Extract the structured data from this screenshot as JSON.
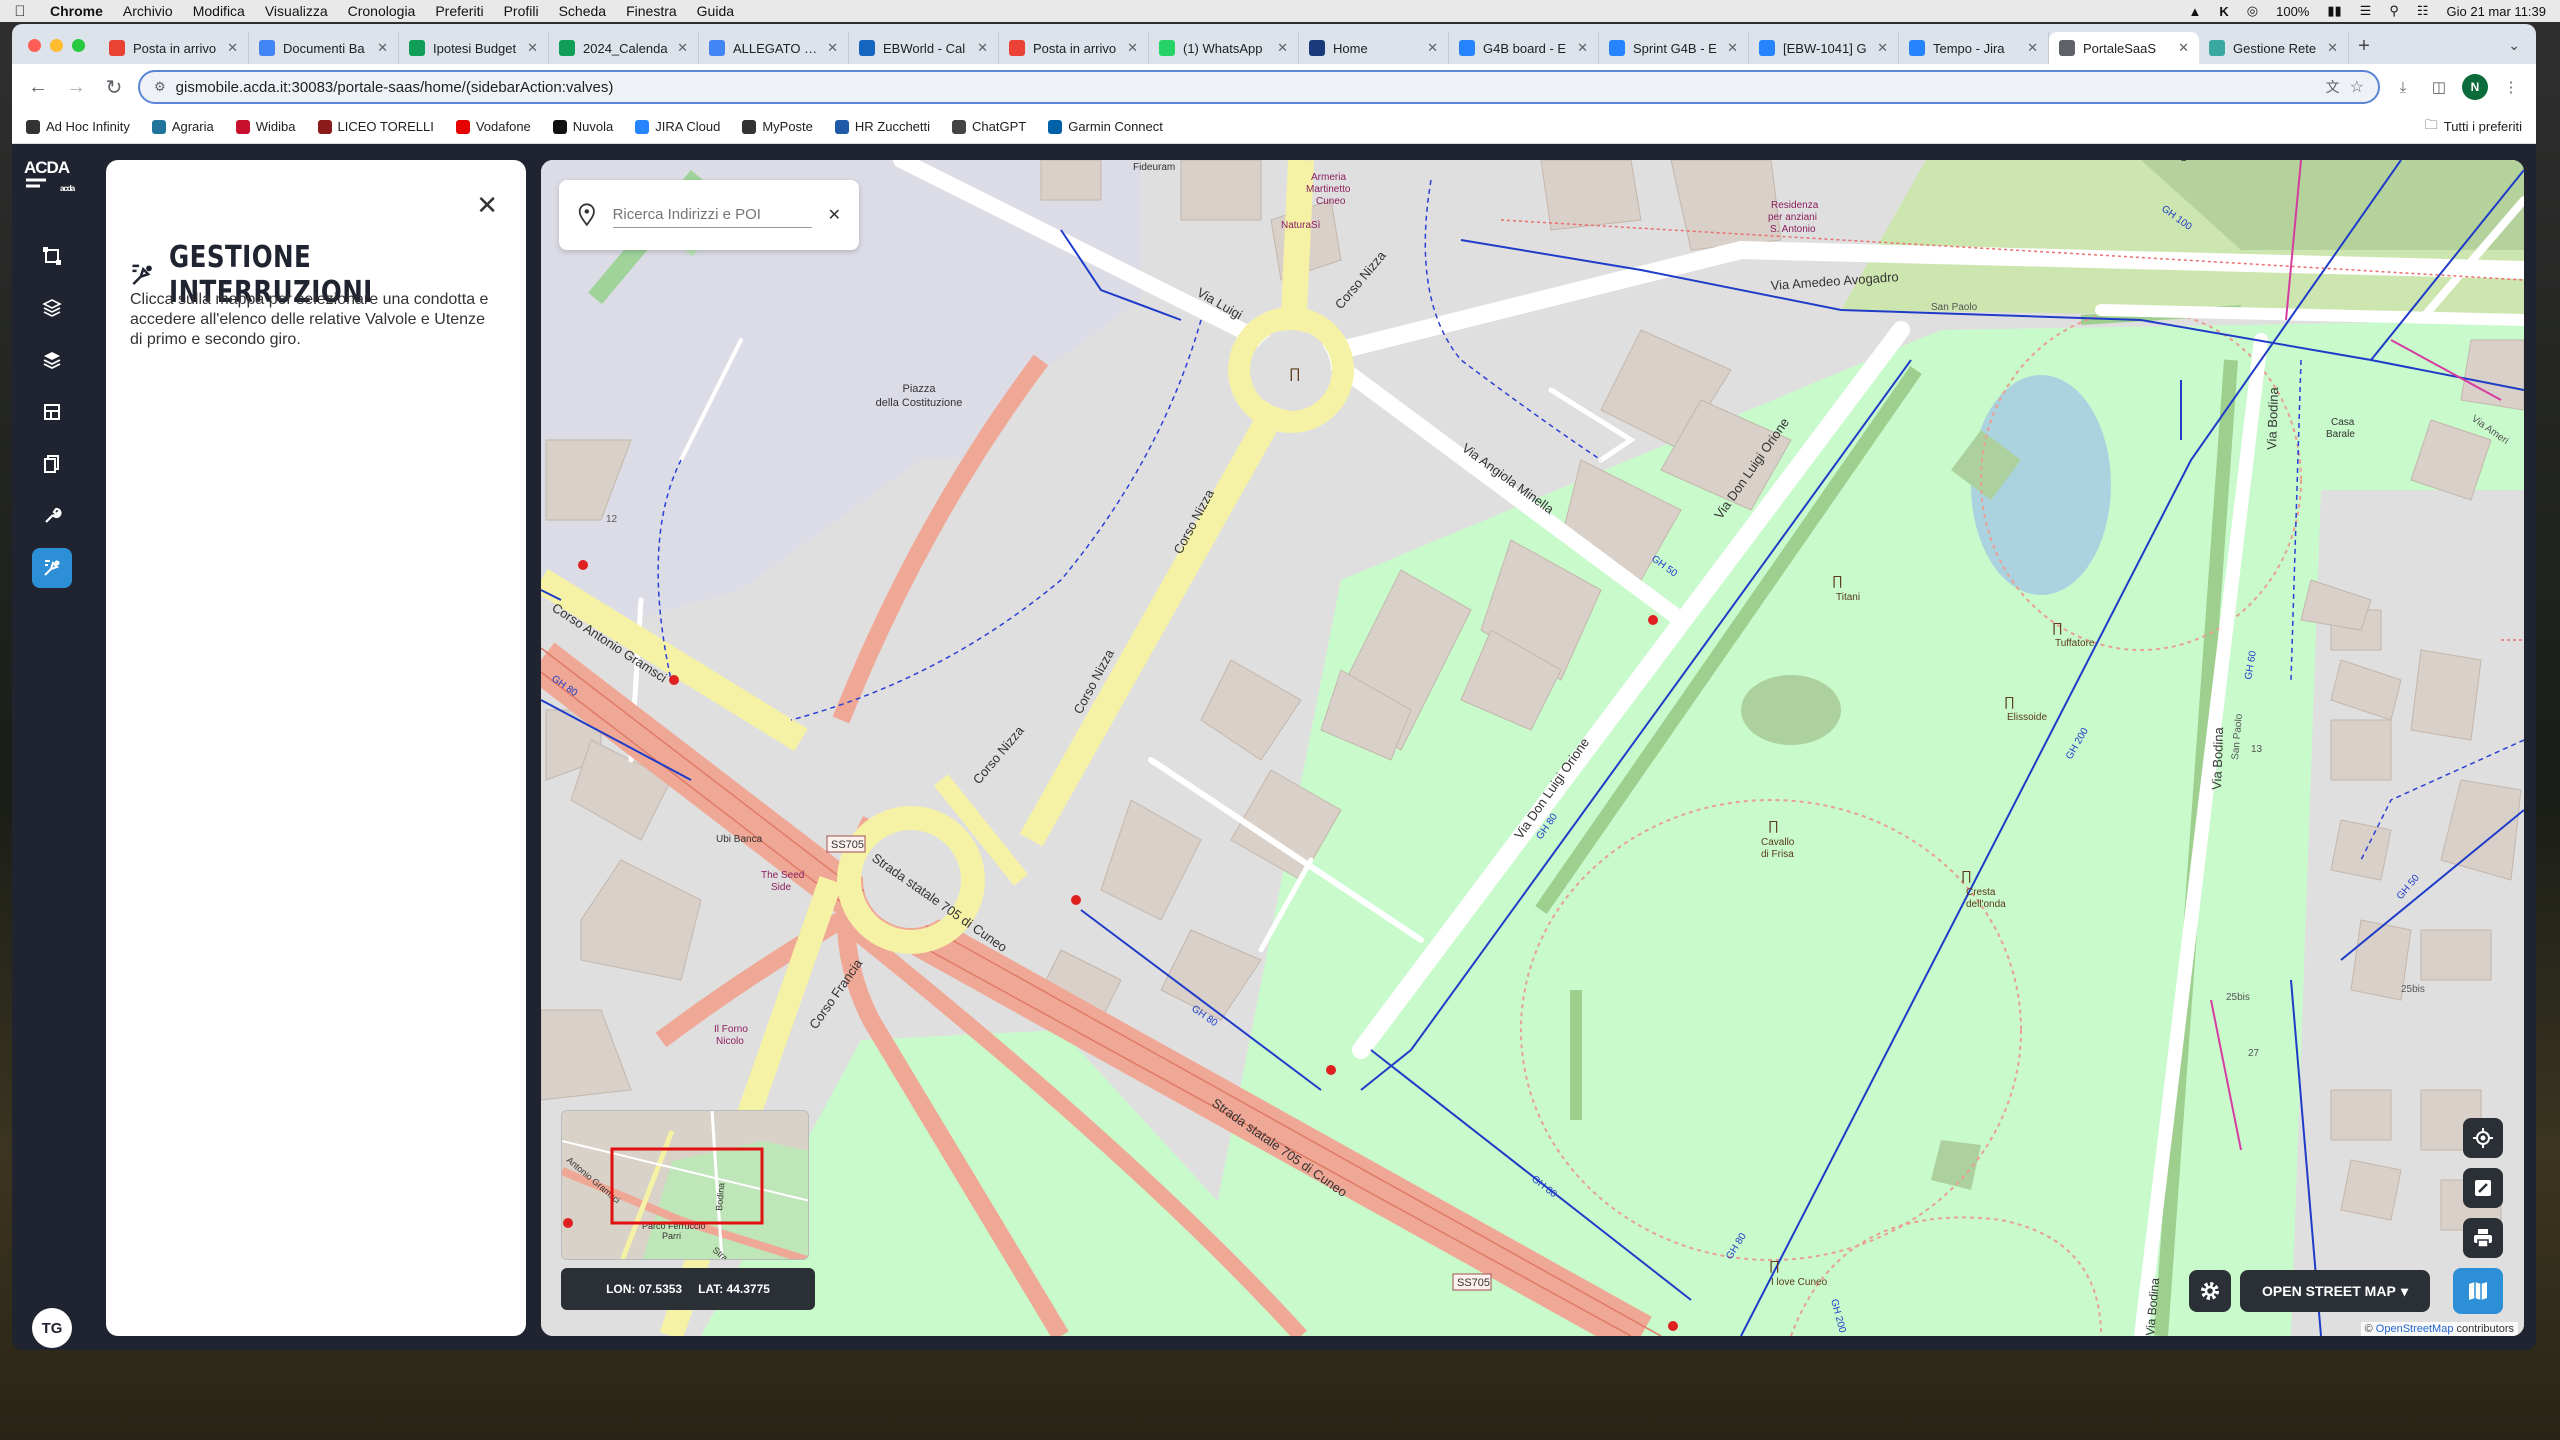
{
  "menubar": {
    "app": "Chrome",
    "items": [
      "Archivio",
      "Modifica",
      "Visualizza",
      "Cronologia",
      "Preferiti",
      "Profili",
      "Scheda",
      "Finestra",
      "Guida"
    ],
    "battery": "100%",
    "datetime": "Gio 21 mar  11:39"
  },
  "tabs": [
    {
      "label": "Posta in arrivo",
      "color": "#ea4335"
    },
    {
      "label": "Documenti Ba",
      "color": "#4285f4"
    },
    {
      "label": "Ipotesi Budget",
      "color": "#0f9d58"
    },
    {
      "label": "2024_Calenda",
      "color": "#0f9d58"
    },
    {
      "label": "ALLEGATO 1 D",
      "color": "#4285f4"
    },
    {
      "label": "EBWorld - Cal",
      "color": "#1565c0"
    },
    {
      "label": "Posta in arrivo",
      "color": "#ea4335"
    },
    {
      "label": "(1) WhatsApp",
      "color": "#25d366"
    },
    {
      "label": "Home",
      "color": "#1a3a7a"
    },
    {
      "label": "G4B board - E",
      "color": "#2684ff"
    },
    {
      "label": "Sprint G4B - E",
      "color": "#2684ff"
    },
    {
      "label": "[EBW-1041] G",
      "color": "#2684ff"
    },
    {
      "label": "Tempo - Jira",
      "color": "#2684ff"
    },
    {
      "label": "PortaleSaaS",
      "color": "#5f6368",
      "active": true
    },
    {
      "label": "Gestione Rete",
      "color": "#3aa7a0"
    }
  ],
  "toolbar": {
    "url": "gismobile.acda.it:30083/portale-saas/home/(sidebarAction:valves)",
    "profile_initial": "N"
  },
  "bookmarks": [
    {
      "label": "Ad Hoc Infinity",
      "color": "#333"
    },
    {
      "label": "Agraria",
      "color": "#21759b"
    },
    {
      "label": "Widiba",
      "color": "#c8102e"
    },
    {
      "label": "LICEO TORELLI",
      "color": "#8b1a1a"
    },
    {
      "label": "Vodafone",
      "color": "#e60000"
    },
    {
      "label": "Nuvola",
      "color": "#111"
    },
    {
      "label": "JIRA Cloud",
      "color": "#2684ff"
    },
    {
      "label": "MyPoste",
      "color": "#333"
    },
    {
      "label": "HR Zucchetti",
      "color": "#1e5aa8"
    },
    {
      "label": "ChatGPT",
      "color": "#444"
    },
    {
      "label": "Garmin Connect",
      "color": "#0061a8"
    }
  ],
  "bookmarks_all": "Tutti i preferiti",
  "app": {
    "logo": "ACDA",
    "logo_sub": "acda",
    "user_initials": "TG",
    "panel": {
      "title": "GESTIONE INTERRUZIONI",
      "description": "Clicca sulla mappa per selezionare una condotta e accedere all'elenco delle relative Valvole e Utenze di primo e secondo giro."
    }
  },
  "map": {
    "search_placeholder": "Ricerca Indirizzi e POI",
    "lon_label": "LON: 07.5353",
    "lat_label": "LAT: 44.3775",
    "basemap": "OPEN STREET MAP",
    "attribution_prefix": "©",
    "attribution_link": "OpenStreetMap",
    "attribution_suffix": "contributors",
    "labels": {
      "via_amedeo": "Via Amedeo Avogadro",
      "via_angiola": "Via Angiola Minella",
      "via_don_luigi": "Via Don Luigi Orione",
      "via_don_luigi2": "Via Don Luigi Orione",
      "via_bodina": "Via Bodina",
      "via_bodina2": "Via Bodina",
      "via_luigi": "Via Luigi",
      "corso_nizza1": "Corso Nizza",
      "corso_nizza2": "Corso Nizza",
      "corso_nizza3": "Corso Nizza",
      "corso_nizza4": "Corso Nizza",
      "corso_gramsci": "Corso Antonio Gramsci",
      "corso_francia": "Corso Francia",
      "ss705_a": "Strada statale 705 di Cuneo",
      "ss705_b": "Strada statale 705 di Cuneo",
      "ss705_badge1": "SS705",
      "ss705_badge2": "SS705",
      "piazza": "Piazza",
      "piazza2": "della Costituzione",
      "titani": "Titani",
      "tuffatore": "Tuffatore",
      "elissoide": "Elissoide",
      "cavallo": "Cavallo",
      "cavallo2": "di Frisa",
      "cresta": "Cresta",
      "cresta2": "dell'onda",
      "ilove": "I love Cuneo",
      "casa": "Casa",
      "casa2": "Barale",
      "residenza1": "Residenza",
      "residenza2": "per anziani",
      "residenza3": "S. Antonio",
      "ubi": "Ubi Banca",
      "seed1": "The Seed",
      "seed2": "Side",
      "forno1": "Il Forno",
      "forno2": "Nicolo",
      "armeria1": "Armeria",
      "armeria2": "Martinetto",
      "armeria3": "Cuneo",
      "naturasi": "NaturaSì",
      "fideuram": "Fideuram",
      "gh80_a": "GH 80",
      "gh80_b": "GH 80",
      "gh80_c": "GH 80",
      "gh80_d": "GH 80",
      "gh80_e": "GH 80",
      "gh200_a": "GH 200",
      "gh200_b": "GH 200",
      "gh100": "GH 100",
      "gh60": "GH 60",
      "gh50_a": "GH 50",
      "gh50_b": "GH 50",
      "via_ameri": "Via Ameri",
      "san_paolo1": "San Paolo",
      "san_paolo2": "San Paolo",
      "n25bis_a": "25bis",
      "n25bis_b": "25bis",
      "n27": "27",
      "n12": "12",
      "n13": "13",
      "n2": "2"
    },
    "minimap": {
      "labels": {
        "parco": "Parco Ferruccio",
        "parri": "Parri",
        "bodina": "Bodina",
        "strada": "Strada",
        "gramsci": "Antonio Gramsci"
      }
    }
  },
  "colors": {
    "accent": "#2d8fd5",
    "dark": "#1f2430",
    "network_blue": "#1f3cc8",
    "primary_road": "#f7fabf",
    "trunk_road": "#f9b29c",
    "park": "#c8facc",
    "building": "#d9d0c9"
  }
}
